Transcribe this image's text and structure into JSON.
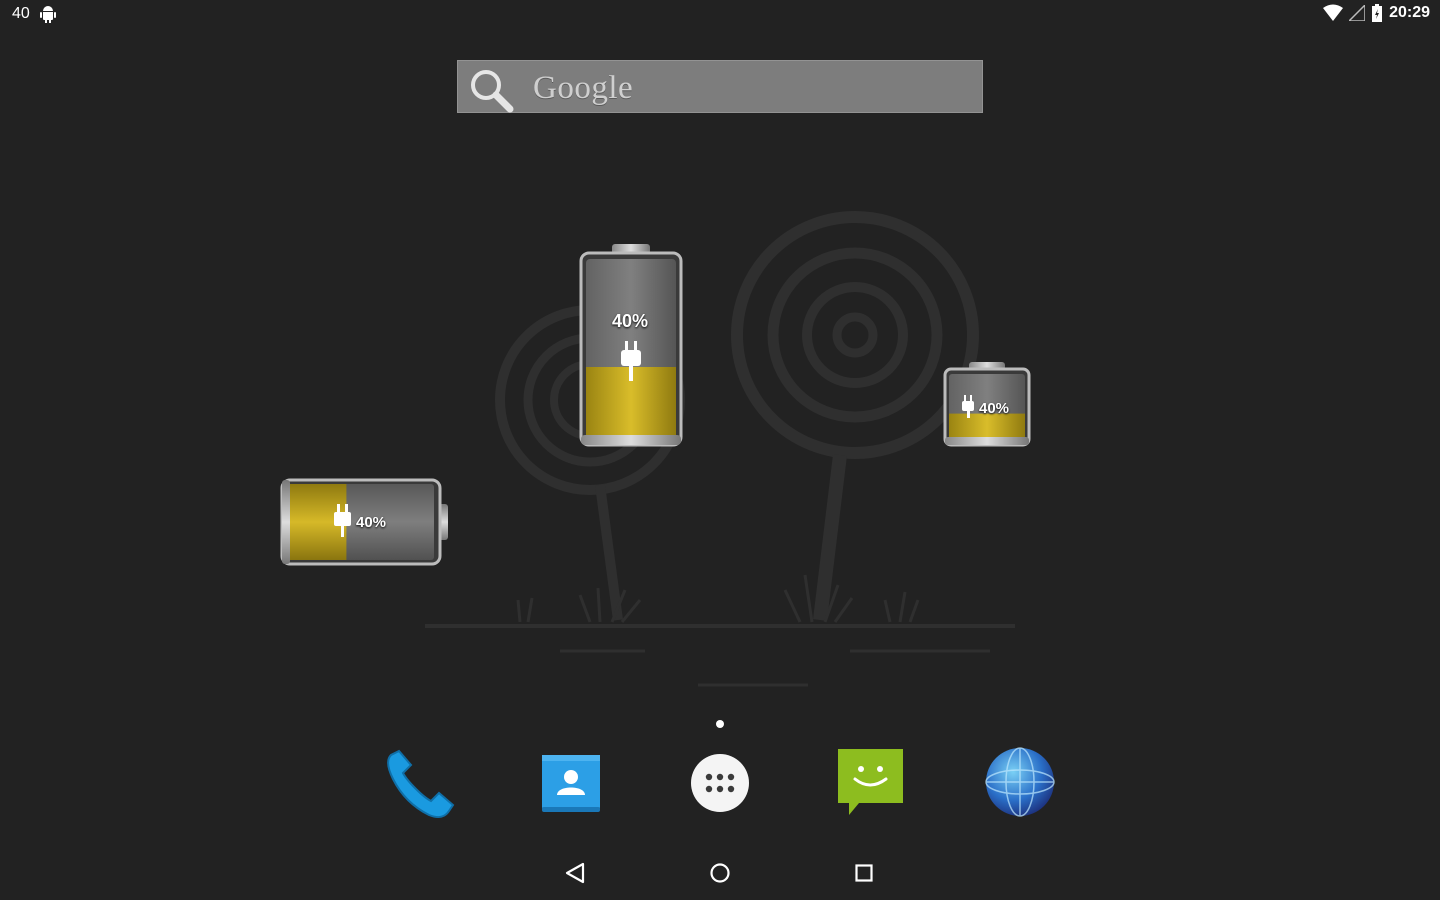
{
  "status_bar": {
    "notification_count": "40",
    "time": "20:29",
    "icons": [
      "android-notification-icon",
      "wifi-icon",
      "cell-signal-icon",
      "battery-charging-icon"
    ]
  },
  "search_widget": {
    "label": "Google",
    "icon": "search-icon"
  },
  "battery_widgets": [
    {
      "orientation": "vertical-large",
      "level_percent": 40,
      "label": "40%",
      "charging": true
    },
    {
      "orientation": "vertical-small",
      "level_percent": 40,
      "label": "40%",
      "charging": true
    },
    {
      "orientation": "horizontal",
      "level_percent": 40,
      "label": "40%",
      "charging": true
    }
  ],
  "home_pages": {
    "count": 1,
    "current": 1
  },
  "dock": {
    "apps": [
      {
        "name": "phone",
        "icon": "phone-icon"
      },
      {
        "name": "contacts",
        "icon": "contacts-icon"
      },
      {
        "name": "app-drawer",
        "icon": "app-drawer-icon"
      },
      {
        "name": "messaging",
        "icon": "messaging-icon"
      },
      {
        "name": "browser",
        "icon": "globe-icon"
      }
    ]
  },
  "navigation": {
    "buttons": [
      "back",
      "home",
      "recents"
    ]
  },
  "colors": {
    "background": "#222222",
    "battery_fill": "#c9ad1c",
    "phone_blue": "#1a9ae0",
    "message_green": "#8dbd1f"
  }
}
